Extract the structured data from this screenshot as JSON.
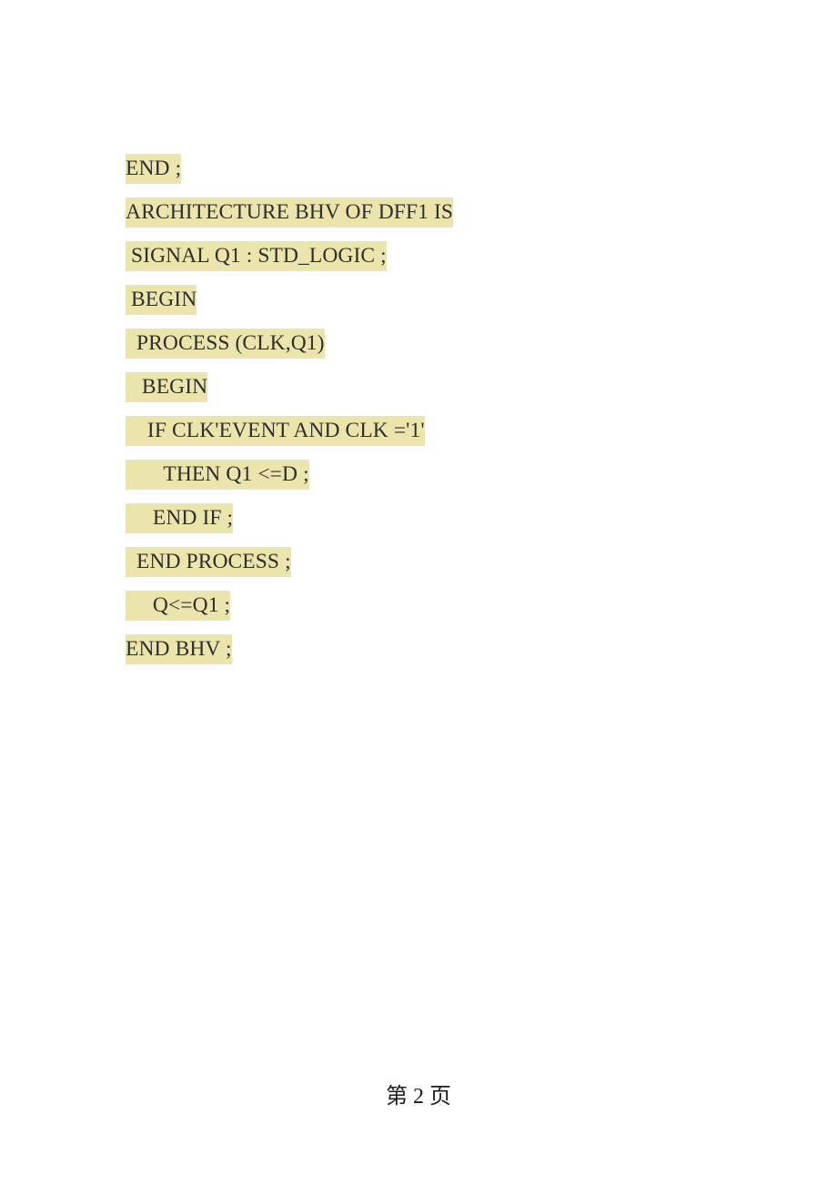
{
  "document": {
    "background_color": "#ffffff",
    "highlight_color": "#ebe5ad",
    "text_color": "#2e2e2e",
    "code_lines": [
      {
        "text": "END ;"
      },
      {
        "text": "ARCHITECTURE BHV OF DFF1 IS"
      },
      {
        "text": " SIGNAL Q1 : STD_LOGIC ;"
      },
      {
        "text": " BEGIN"
      },
      {
        "text": "  PROCESS (CLK,Q1)"
      },
      {
        "text": "   BEGIN"
      },
      {
        "text": "    IF CLK'EVENT AND CLK ='1'"
      },
      {
        "text": "       THEN Q1 <=D ;"
      },
      {
        "text": "     END IF ;"
      },
      {
        "text": "  END PROCESS ;"
      },
      {
        "text": "     Q<=Q1 ;"
      },
      {
        "text": "END BHV ;"
      }
    ],
    "footer": {
      "text": "第 2 页"
    }
  }
}
